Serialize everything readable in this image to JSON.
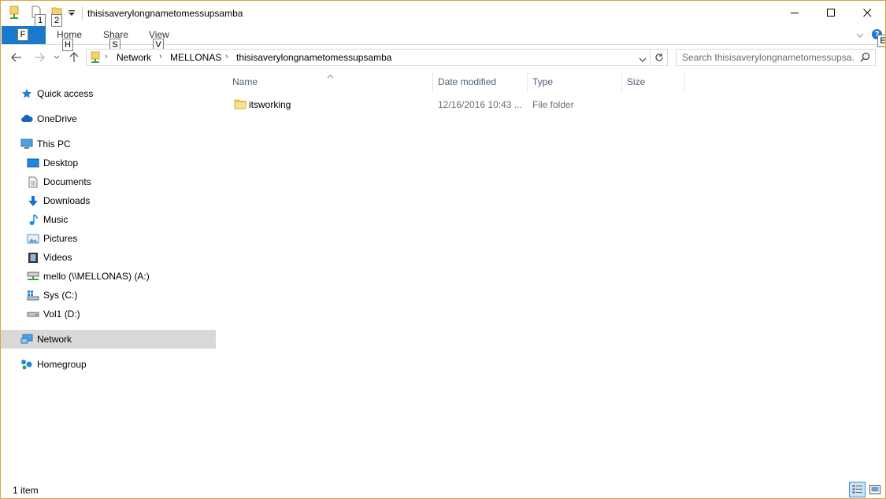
{
  "window": {
    "title": "thisisaverylongnametomessupsamba",
    "qat_keytips": [
      "1",
      "2"
    ]
  },
  "ribbon": {
    "file_keytip": "F",
    "tabs": [
      {
        "label": "Home",
        "keytip": "H"
      },
      {
        "label": "Share",
        "keytip": "S"
      },
      {
        "label": "View",
        "keytip": "V"
      }
    ],
    "help_keytip": "E"
  },
  "address": {
    "crumbs": [
      "Network",
      "MELLONAS",
      "thisisaverylongnametomessupsamba"
    ]
  },
  "search": {
    "placeholder": "Search thisisaverylongnametomessupsa..."
  },
  "nav": {
    "items": [
      {
        "label": "Quick access",
        "icon": "star-icon"
      },
      {
        "label": "OneDrive",
        "icon": "cloud-icon"
      },
      {
        "label": "This PC",
        "icon": "computer-icon"
      },
      {
        "label": "Desktop",
        "icon": "desktop-icon"
      },
      {
        "label": "Documents",
        "icon": "document-icon"
      },
      {
        "label": "Downloads",
        "icon": "download-icon"
      },
      {
        "label": "Music",
        "icon": "music-icon"
      },
      {
        "label": "Pictures",
        "icon": "pictures-icon"
      },
      {
        "label": "Videos",
        "icon": "video-icon"
      },
      {
        "label": "mello (\\\\MELLONAS) (A:)",
        "icon": "network-drive-icon"
      },
      {
        "label": "Sys (C:)",
        "icon": "system-drive-icon"
      },
      {
        "label": "Vol1 (D:)",
        "icon": "drive-icon"
      },
      {
        "label": "Network",
        "icon": "network-icon",
        "selected": true
      },
      {
        "label": "Homegroup",
        "icon": "homegroup-icon"
      }
    ]
  },
  "content": {
    "columns": [
      "Name",
      "Date modified",
      "Type",
      "Size"
    ],
    "rows": [
      {
        "name": "itsworking",
        "date": "12/16/2016 10:43 ...",
        "type": "File folder",
        "size": ""
      }
    ]
  },
  "status": {
    "item_count": "1 item"
  },
  "colors": {
    "accent": "#1979ca",
    "border": "#e1a23a",
    "selected": "#d9d9d9",
    "header_text": "#4c607a"
  }
}
